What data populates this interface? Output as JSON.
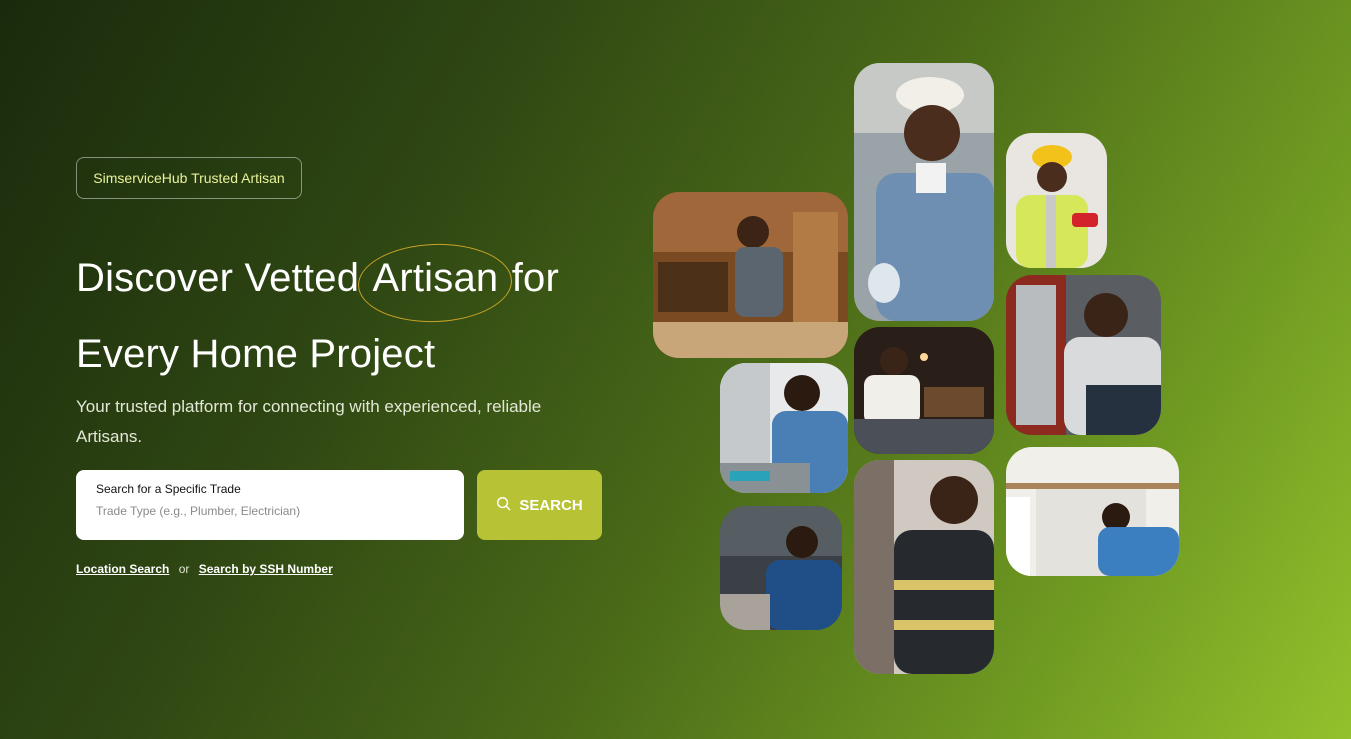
{
  "hero": {
    "badge": "SimserviceHub Trusted Artisan",
    "headline_part1": "Discover Vetted",
    "headline_highlight": "Artisan",
    "headline_part2": "for",
    "headline_line2": "Every Home Project",
    "subtitle": "Your trusted platform for connecting with experienced, reliable Artisans."
  },
  "search": {
    "label": "Search for a Specific Trade",
    "placeholder": "Trade Type (e.g., Plumber, Electrician)",
    "button_label": "SEARCH",
    "button_icon": "search-icon"
  },
  "links": {
    "location": "Location Search",
    "separator": "or",
    "ssh": "Search by SSH Number"
  },
  "colors": {
    "accent_button": "#b7c234",
    "badge_text": "#e9f29a",
    "oval": "#c9a227"
  },
  "gallery": [
    {
      "subject": "carpenter-workshop"
    },
    {
      "subject": "smiling-worker-hardhat"
    },
    {
      "subject": "safety-inspector-yellow-helmet"
    },
    {
      "subject": "electronics-technician"
    },
    {
      "subject": "woman-at-table"
    },
    {
      "subject": "mechanic-wrench"
    },
    {
      "subject": "engineer-woman"
    },
    {
      "subject": "firefighter"
    },
    {
      "subject": "plumber-under-sink"
    }
  ]
}
